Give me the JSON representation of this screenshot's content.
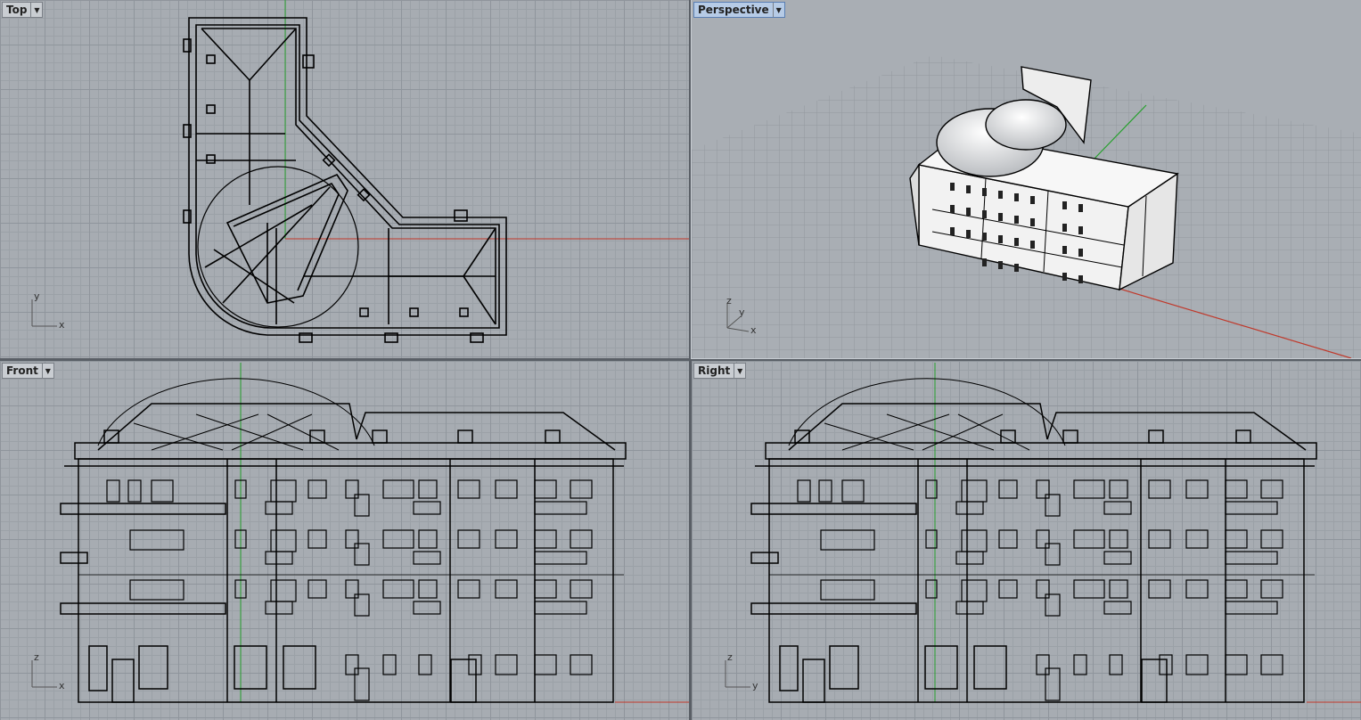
{
  "viewports": {
    "top": {
      "name": "Top",
      "menu_icon": "dropdown-arrow-icon",
      "axis1": "y",
      "axis2": "x"
    },
    "perspective": {
      "name": "Perspective",
      "menu_icon": "dropdown-arrow-icon",
      "axis1": "z",
      "axis2": "y",
      "axis3": "x",
      "active": true
    },
    "front": {
      "name": "Front",
      "menu_icon": "dropdown-arrow-icon",
      "axis1": "z",
      "axis2": "x"
    },
    "right": {
      "name": "Right",
      "menu_icon": "dropdown-arrow-icon",
      "axis1": "z",
      "axis2": "y"
    }
  },
  "colors": {
    "viewport_bg": "#a7acb2",
    "grid": "#8f959c",
    "x_axis": "#c0392b",
    "y_axis": "#27a02e",
    "geometry": "#000000",
    "active_label": "#b6cbe6"
  }
}
